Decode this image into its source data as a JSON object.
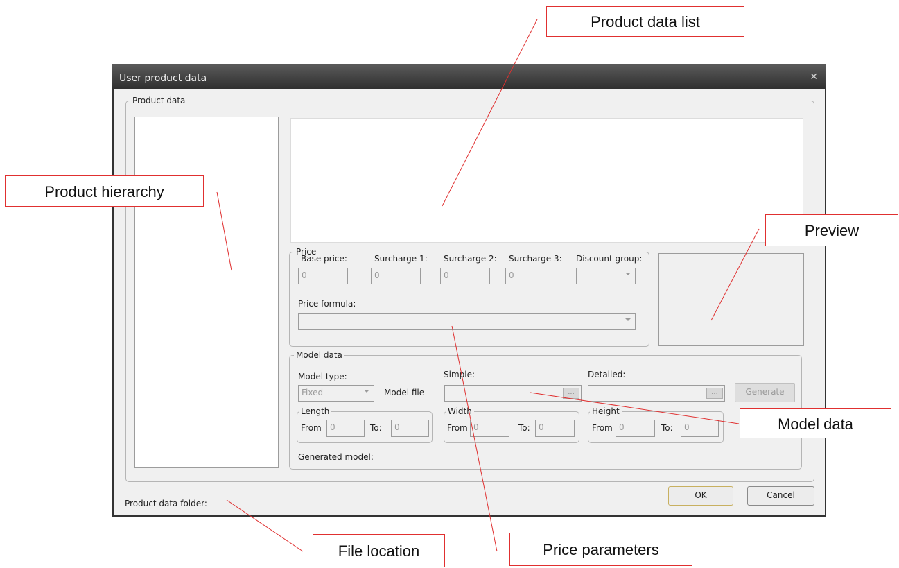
{
  "window": {
    "title": "User product data"
  },
  "product_data": {
    "legend": "Product data"
  },
  "price": {
    "legend": "Price",
    "base_price_label": "Base price:",
    "surcharge1_label": "Surcharge 1:",
    "surcharge2_label": "Surcharge 2:",
    "surcharge3_label": "Surcharge 3:",
    "discount_group_label": "Discount group:",
    "base_price_value": "0",
    "surcharge1_value": "0",
    "surcharge2_value": "0",
    "surcharge3_value": "0",
    "price_formula_label": "Price formula:"
  },
  "model": {
    "legend": "Model data",
    "model_type_label": "Model type:",
    "model_type_value": "Fixed",
    "model_file_label": "Model file",
    "simple_label": "Simple:",
    "detailed_label": "Detailed:",
    "browse_label": "...",
    "generate_label": "Generate",
    "length_legend": "Length",
    "width_legend": "Width",
    "height_legend": "Height",
    "from_label": "From",
    "to_label": "To:",
    "zero": "0",
    "generated_model_label": "Generated model:"
  },
  "footer": {
    "folder_label": "Product data folder:",
    "ok_label": "OK",
    "cancel_label": "Cancel"
  },
  "callouts": {
    "product_data_list": "Product data list",
    "product_hierarchy": "Product hierarchy",
    "preview": "Preview",
    "model_data": "Model data",
    "file_location": "File location",
    "price_parameters": "Price parameters"
  },
  "colors": {
    "callout_border": "#e03030",
    "title_bar": "#3a3a3a"
  }
}
